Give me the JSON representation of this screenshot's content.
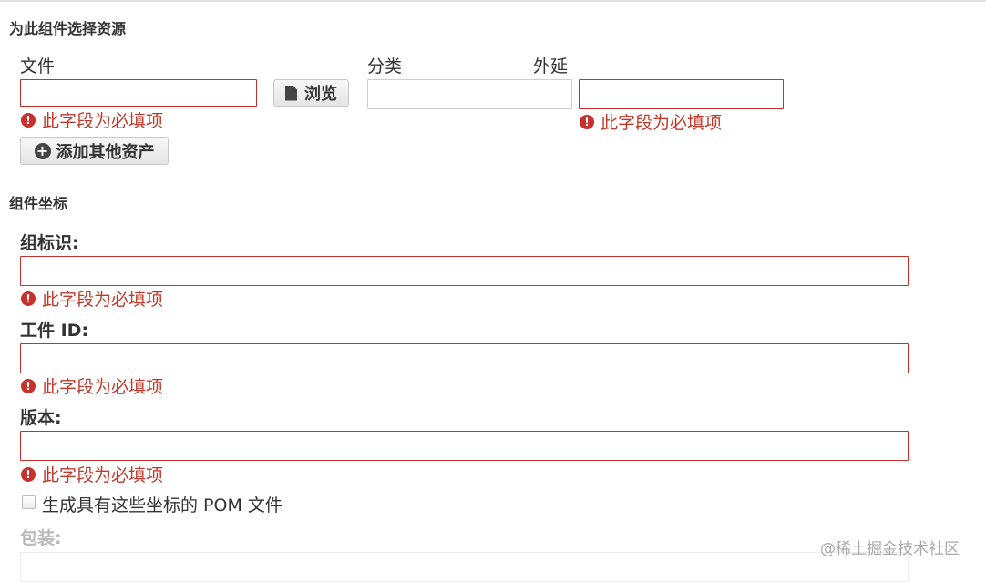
{
  "section_resource": {
    "title": "为此组件选择资源"
  },
  "asset": {
    "file_label": "文件",
    "classifier_label": "分类",
    "extension_label": "外延",
    "file_value": "",
    "classifier_value": "",
    "extension_value": "",
    "browse_label": "浏览",
    "add_asset_label": "添加其他资产",
    "required_error": "此字段为必填项"
  },
  "section_coordinates": {
    "title": "组件坐标"
  },
  "coordinates": {
    "group_label": "组标识:",
    "artifact_label": "工件 ID:",
    "version_label": "版本:",
    "group_value": "",
    "artifact_value": "",
    "version_value": "",
    "required_error": "此字段为必填项",
    "generate_pom_label": "生成具有这些坐标的 POM 文件",
    "generate_pom_checked": false,
    "packaging_label": "包装:",
    "packaging_value": ""
  },
  "watermark": "@稀土掘金技术社区",
  "colors": {
    "error": "#c9302c",
    "error_text": "#c0392b",
    "muted": "#b9b9b9"
  },
  "icons": {
    "error": "exclamation-circle-icon",
    "browse": "file-icon",
    "add": "plus-circle-icon"
  }
}
